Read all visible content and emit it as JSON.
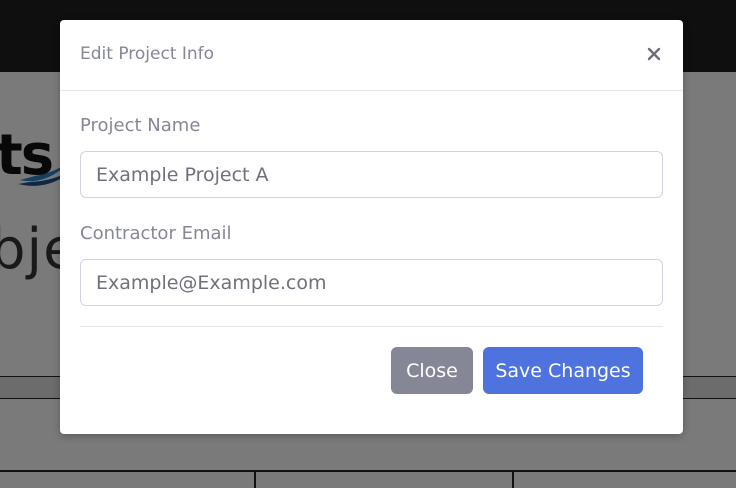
{
  "background": {
    "logo_fragment": "ts",
    "heading_fragment": "bjec"
  },
  "modal": {
    "title": "Edit Project Info",
    "close_icon": "close-icon",
    "fields": [
      {
        "label": "Project Name",
        "value": "Example Project A"
      },
      {
        "label": "Contractor Email",
        "value": "Example@Example.com"
      }
    ],
    "buttons": {
      "close_label": "Close",
      "save_label": "Save Changes"
    }
  },
  "colors": {
    "primary": "#4e73df",
    "secondary": "#858796",
    "text_muted": "#858796",
    "backdrop": "rgba(0,0,0,0.5)"
  }
}
